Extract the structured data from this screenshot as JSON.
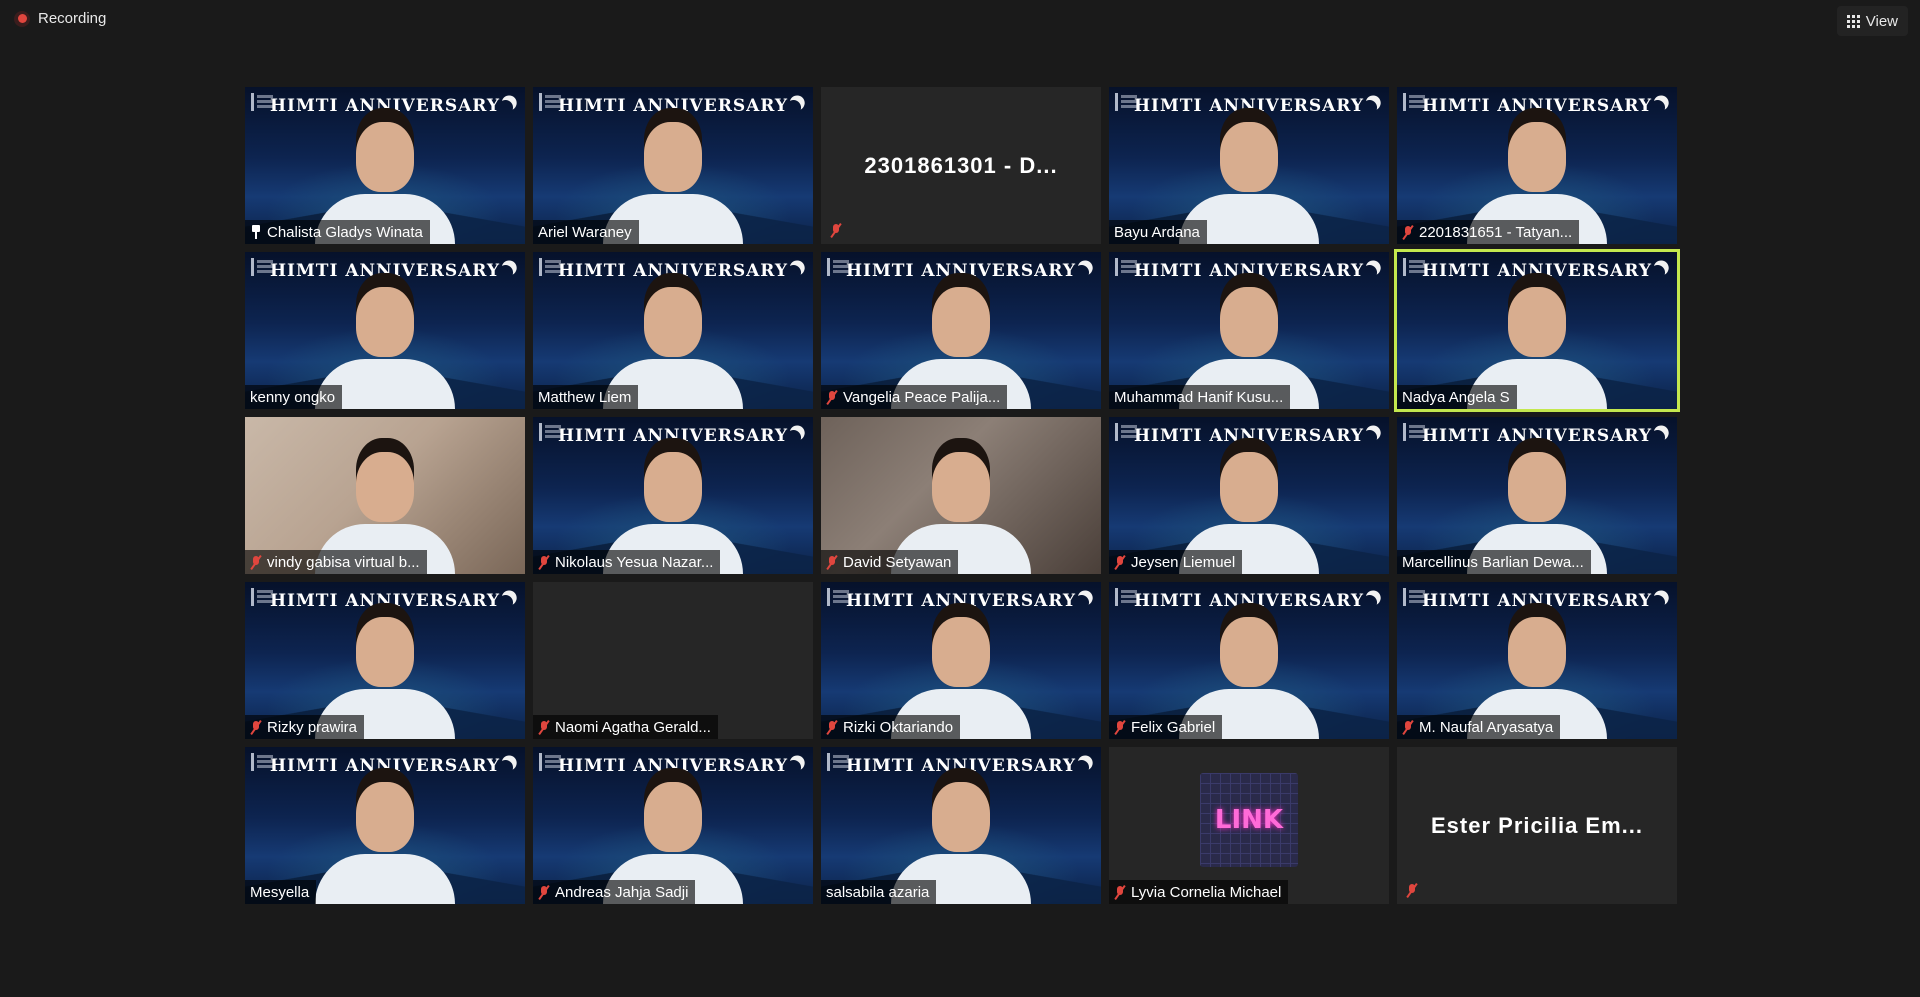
{
  "recording": {
    "label": "Recording"
  },
  "view_button": {
    "label": "View"
  },
  "banner_text": "HIMTI ANNIVERSARY",
  "link_logo_text": "LINK",
  "participants": [
    {
      "name": "Chalista Gladys Winata",
      "muted": false,
      "pinned": true,
      "video": "vbg"
    },
    {
      "name": "Ariel Waraney",
      "muted": false,
      "pinned": false,
      "video": "vbg"
    },
    {
      "name": "2301861301 - D...",
      "muted": true,
      "pinned": false,
      "video": "off-name"
    },
    {
      "name": "Bayu Ardana",
      "muted": false,
      "pinned": false,
      "video": "vbg"
    },
    {
      "name": "2201831651 - Tatyan...",
      "muted": true,
      "pinned": false,
      "video": "vbg"
    },
    {
      "name": "kenny ongko",
      "muted": false,
      "pinned": false,
      "video": "vbg"
    },
    {
      "name": "Matthew Liem",
      "muted": false,
      "pinned": false,
      "video": "vbg"
    },
    {
      "name": "Vangelia Peace Palija...",
      "muted": true,
      "pinned": false,
      "video": "vbg"
    },
    {
      "name": "Muhammad Hanif Kusu...",
      "muted": false,
      "pinned": false,
      "video": "vbg"
    },
    {
      "name": "Nadya Angela S",
      "muted": false,
      "pinned": false,
      "video": "vbg",
      "active": true
    },
    {
      "name": "vindy gabisa virtual b...",
      "muted": true,
      "pinned": false,
      "video": "room2"
    },
    {
      "name": "Nikolaus Yesua Nazar...",
      "muted": true,
      "pinned": false,
      "video": "vbg"
    },
    {
      "name": "David Setyawan",
      "muted": true,
      "pinned": false,
      "video": "room"
    },
    {
      "name": "Jeysen Liemuel",
      "muted": true,
      "pinned": false,
      "video": "vbg"
    },
    {
      "name": "Marcellinus Barlian Dewa...",
      "muted": false,
      "pinned": false,
      "video": "vbg"
    },
    {
      "name": "Rizky prawira",
      "muted": true,
      "pinned": false,
      "video": "vbg"
    },
    {
      "name": "Naomi Agatha Gerald...",
      "muted": true,
      "pinned": false,
      "video": "off"
    },
    {
      "name": "Rizki Oktariando",
      "muted": true,
      "pinned": false,
      "video": "vbg"
    },
    {
      "name": "Felix Gabriel",
      "muted": true,
      "pinned": false,
      "video": "vbg"
    },
    {
      "name": "M. Naufal Aryasatya",
      "muted": true,
      "pinned": false,
      "video": "vbg"
    },
    {
      "name": "Mesyella",
      "muted": false,
      "pinned": false,
      "video": "vbg"
    },
    {
      "name": "Andreas Jahja Sadji",
      "muted": true,
      "pinned": false,
      "video": "vbg"
    },
    {
      "name": "salsabila azaria",
      "muted": false,
      "pinned": false,
      "video": "vbg"
    },
    {
      "name": "Lyvia Cornelia Michael",
      "muted": true,
      "pinned": false,
      "video": "link"
    },
    {
      "name": "Ester Pricilia Em...",
      "muted": true,
      "pinned": false,
      "video": "off-name"
    }
  ]
}
